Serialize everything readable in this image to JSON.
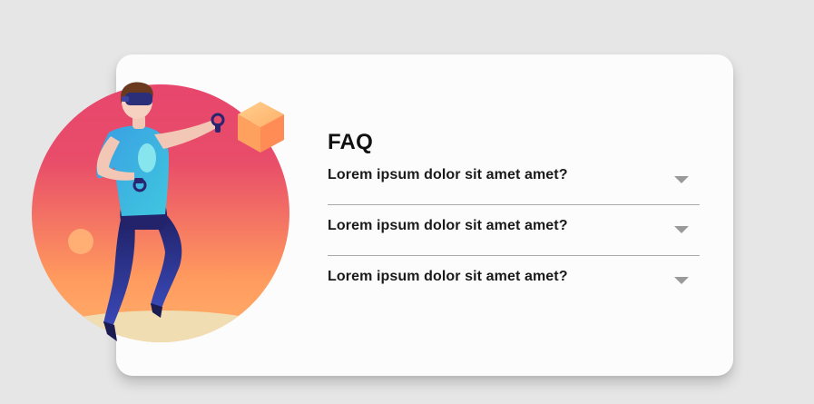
{
  "faq": {
    "title": "FAQ",
    "items": [
      {
        "question": "Lorem ipsum dolor sit amet amet?",
        "icon": "chevron-down-icon"
      },
      {
        "question": "Lorem ipsum dolor sit amet amet?",
        "icon": "chevron-down-icon"
      },
      {
        "question": "Lorem ipsum dolor sit amet amet?",
        "icon": "chevron-down-icon"
      }
    ]
  },
  "illustration": {
    "subject": "vr-player-icon",
    "colors": {
      "circle_top": "#e7466d",
      "circle_bottom": "#ffa35e",
      "ground": "#f0ddb1",
      "shirt": "#3ab7e3",
      "pants": "#2a2a7a",
      "cube": "#ffb06d"
    }
  }
}
